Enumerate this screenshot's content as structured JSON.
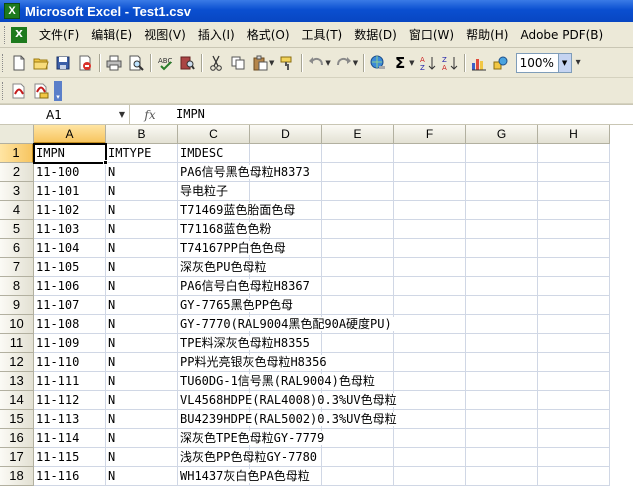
{
  "window": {
    "title": "Microsoft Excel - Test1.csv",
    "app_icon": "X"
  },
  "menu": [
    "文件(F)",
    "编辑(E)",
    "视图(V)",
    "插入(I)",
    "格式(O)",
    "工具(T)",
    "数据(D)",
    "窗口(W)",
    "帮助(H)",
    "Adobe PDF(B)"
  ],
  "toolbar": {
    "zoom": "100%"
  },
  "formula_bar": {
    "name_box": "A1",
    "fx": "fx",
    "formula": "IMPN"
  },
  "columns": [
    "A",
    "B",
    "C",
    "D",
    "E",
    "F",
    "G",
    "H"
  ],
  "rows": [
    {
      "num": "1",
      "a": "IMPN",
      "b": "IMTYPE",
      "c": "IMDESC"
    },
    {
      "num": "2",
      "a": "11-100",
      "b": "N",
      "c": "PA6信号黑色母粒H8373"
    },
    {
      "num": "3",
      "a": "11-101",
      "b": "N",
      "c": "导电粒子"
    },
    {
      "num": "4",
      "a": "11-102",
      "b": "N",
      "c": "T71469蓝色胎面色母"
    },
    {
      "num": "5",
      "a": "11-103",
      "b": "N",
      "c": "T71168蓝色色粉"
    },
    {
      "num": "6",
      "a": "11-104",
      "b": "N",
      "c": "T74167PP白色色母"
    },
    {
      "num": "7",
      "a": "11-105",
      "b": "N",
      "c": "深灰色PU色母粒"
    },
    {
      "num": "8",
      "a": "11-106",
      "b": "N",
      "c": "PA6信号白色母粒H8367"
    },
    {
      "num": "9",
      "a": "11-107",
      "b": "N",
      "c": "GY-7765黑色PP色母"
    },
    {
      "num": "10",
      "a": "11-108",
      "b": "N",
      "c": "GY-7770(RAL9004黑色配90A硬度PU)"
    },
    {
      "num": "11",
      "a": "11-109",
      "b": "N",
      "c": "TPE料深灰色母粒H8355"
    },
    {
      "num": "12",
      "a": "11-110",
      "b": "N",
      "c": "PP料光亮银灰色母粒H8356"
    },
    {
      "num": "13",
      "a": "11-111",
      "b": "N",
      "c": "TU60DG-1信号黑(RAL9004)色母粒"
    },
    {
      "num": "14",
      "a": "11-112",
      "b": "N",
      "c": "VL4568HDPE(RAL4008)0.3%UV色母粒"
    },
    {
      "num": "15",
      "a": "11-113",
      "b": "N",
      "c": "BU4239HDPE(RAL5002)0.3%UV色母粒"
    },
    {
      "num": "16",
      "a": "11-114",
      "b": "N",
      "c": "深灰色TPE色母粒GY-7779"
    },
    {
      "num": "17",
      "a": "11-115",
      "b": "N",
      "c": "浅灰色PP色母粒GY-7780"
    },
    {
      "num": "18",
      "a": "11-116",
      "b": "N",
      "c": "WH1437灰白色PA色母粒"
    }
  ],
  "colors": {
    "title_blue": "#0a4fd0",
    "chrome": "#ece9d8",
    "header_selected": "#f7c560",
    "gridline": "#d0d7e5"
  }
}
